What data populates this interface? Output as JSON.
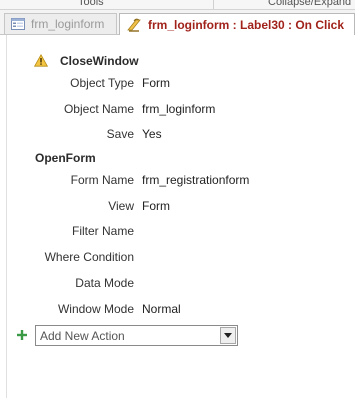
{
  "ribbon": {
    "left_group": "Tools",
    "right_group": "Collapse/Expand"
  },
  "tabs": [
    {
      "label": "frm_loginform",
      "icon": "form-icon",
      "active": false
    },
    {
      "label": "frm_loginform : Label30 : On Click",
      "icon": "macro-icon",
      "active": true
    }
  ],
  "macro": {
    "actions": [
      {
        "name": "CloseWindow",
        "warning_icon": "warning-icon",
        "arguments": [
          {
            "label": "Object Type",
            "value": "Form"
          },
          {
            "label": "Object Name",
            "value": "frm_loginform"
          },
          {
            "label": "Save",
            "value": "Yes"
          }
        ]
      },
      {
        "name": "OpenForm",
        "arguments": [
          {
            "label": "Form Name",
            "value": "frm_registrationform"
          },
          {
            "label": "View",
            "value": "Form"
          },
          {
            "label": "Filter Name",
            "value": ""
          },
          {
            "label": "Where Condition",
            "value": ""
          },
          {
            "label": "Data Mode",
            "value": ""
          },
          {
            "label": "Window Mode",
            "value": "Normal"
          }
        ]
      }
    ],
    "add_action": {
      "plus_icon": "plus-icon",
      "value": "Add New Action",
      "dropdown_icon": "dropdown-arrow-icon"
    }
  }
}
